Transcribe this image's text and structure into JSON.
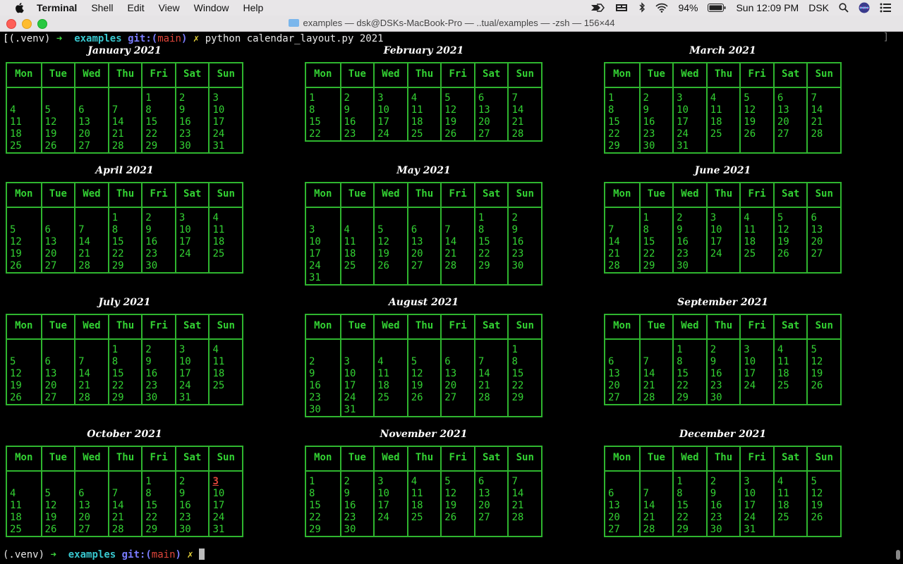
{
  "menubar": {
    "app": "Terminal",
    "items": [
      "Shell",
      "Edit",
      "View",
      "Window",
      "Help"
    ],
    "battery": "94%",
    "clock": "Sun 12:09 PM",
    "user": "DSK"
  },
  "window": {
    "title": "examples — dsk@DSKs-MacBook-Pro — ..tual/examples — -zsh — 156×44"
  },
  "prompt": {
    "venv": "(.venv)",
    "arrow": "➜",
    "dir": "examples",
    "git": "git:(",
    "branch": "main",
    "git_close": ")",
    "dirty": "✗",
    "command": "python calendar_layout.py 2021"
  },
  "weekdays": [
    "Mon",
    "Tue",
    "Wed",
    "Thu",
    "Fri",
    "Sat",
    "Sun"
  ],
  "months": [
    {
      "name": "January 2021",
      "weeks": [
        [
          "",
          "",
          "",
          "",
          "1",
          "2",
          "3"
        ],
        [
          "4",
          "5",
          "6",
          "7",
          "8",
          "9",
          "10"
        ],
        [
          "11",
          "12",
          "13",
          "14",
          "15",
          "16",
          "17"
        ],
        [
          "18",
          "19",
          "20",
          "21",
          "22",
          "23",
          "24"
        ],
        [
          "25",
          "26",
          "27",
          "28",
          "29",
          "30",
          "31"
        ]
      ]
    },
    {
      "name": "February 2021",
      "weeks": [
        [
          "1",
          "2",
          "3",
          "4",
          "5",
          "6",
          "7"
        ],
        [
          "8",
          "9",
          "10",
          "11",
          "12",
          "13",
          "14"
        ],
        [
          "15",
          "16",
          "17",
          "18",
          "19",
          "20",
          "21"
        ],
        [
          "22",
          "23",
          "24",
          "25",
          "26",
          "27",
          "28"
        ]
      ]
    },
    {
      "name": "March 2021",
      "weeks": [
        [
          "1",
          "2",
          "3",
          "4",
          "5",
          "6",
          "7"
        ],
        [
          "8",
          "9",
          "10",
          "11",
          "12",
          "13",
          "14"
        ],
        [
          "15",
          "16",
          "17",
          "18",
          "19",
          "20",
          "21"
        ],
        [
          "22",
          "23",
          "24",
          "25",
          "26",
          "27",
          "28"
        ],
        [
          "29",
          "30",
          "31",
          "",
          "",
          "",
          ""
        ]
      ]
    },
    {
      "name": "April 2021",
      "weeks": [
        [
          "",
          "",
          "",
          "1",
          "2",
          "3",
          "4"
        ],
        [
          "5",
          "6",
          "7",
          "8",
          "9",
          "10",
          "11"
        ],
        [
          "12",
          "13",
          "14",
          "15",
          "16",
          "17",
          "18"
        ],
        [
          "19",
          "20",
          "21",
          "22",
          "23",
          "24",
          "25"
        ],
        [
          "26",
          "27",
          "28",
          "29",
          "30",
          "",
          ""
        ]
      ]
    },
    {
      "name": "May 2021",
      "weeks": [
        [
          "",
          "",
          "",
          "",
          "",
          "1",
          "2"
        ],
        [
          "3",
          "4",
          "5",
          "6",
          "7",
          "8",
          "9"
        ],
        [
          "10",
          "11",
          "12",
          "13",
          "14",
          "15",
          "16"
        ],
        [
          "17",
          "18",
          "19",
          "20",
          "21",
          "22",
          "23"
        ],
        [
          "24",
          "25",
          "26",
          "27",
          "28",
          "29",
          "30"
        ],
        [
          "31",
          "",
          "",
          "",
          "",
          "",
          ""
        ]
      ]
    },
    {
      "name": "June 2021",
      "weeks": [
        [
          "",
          "1",
          "2",
          "3",
          "4",
          "5",
          "6"
        ],
        [
          "7",
          "8",
          "9",
          "10",
          "11",
          "12",
          "13"
        ],
        [
          "14",
          "15",
          "16",
          "17",
          "18",
          "19",
          "20"
        ],
        [
          "21",
          "22",
          "23",
          "24",
          "25",
          "26",
          "27"
        ],
        [
          "28",
          "29",
          "30",
          "",
          "",
          "",
          ""
        ]
      ]
    },
    {
      "name": "July 2021",
      "weeks": [
        [
          "",
          "",
          "",
          "1",
          "2",
          "3",
          "4"
        ],
        [
          "5",
          "6",
          "7",
          "8",
          "9",
          "10",
          "11"
        ],
        [
          "12",
          "13",
          "14",
          "15",
          "16",
          "17",
          "18"
        ],
        [
          "19",
          "20",
          "21",
          "22",
          "23",
          "24",
          "25"
        ],
        [
          "26",
          "27",
          "28",
          "29",
          "30",
          "31",
          ""
        ]
      ]
    },
    {
      "name": "August 2021",
      "weeks": [
        [
          "",
          "",
          "",
          "",
          "",
          "",
          "1"
        ],
        [
          "2",
          "3",
          "4",
          "5",
          "6",
          "7",
          "8"
        ],
        [
          "9",
          "10",
          "11",
          "12",
          "13",
          "14",
          "15"
        ],
        [
          "16",
          "17",
          "18",
          "19",
          "20",
          "21",
          "22"
        ],
        [
          "23",
          "24",
          "25",
          "26",
          "27",
          "28",
          "29"
        ],
        [
          "30",
          "31",
          "",
          "",
          "",
          "",
          ""
        ]
      ]
    },
    {
      "name": "September 2021",
      "weeks": [
        [
          "",
          "",
          "1",
          "2",
          "3",
          "4",
          "5"
        ],
        [
          "6",
          "7",
          "8",
          "9",
          "10",
          "11",
          "12"
        ],
        [
          "13",
          "14",
          "15",
          "16",
          "17",
          "18",
          "19"
        ],
        [
          "20",
          "21",
          "22",
          "23",
          "24",
          "25",
          "26"
        ],
        [
          "27",
          "28",
          "29",
          "30",
          "",
          "",
          ""
        ]
      ]
    },
    {
      "name": "October 2021",
      "weeks": [
        [
          "",
          "",
          "",
          "",
          "1",
          "2",
          "3"
        ],
        [
          "4",
          "5",
          "6",
          "7",
          "8",
          "9",
          "10"
        ],
        [
          "11",
          "12",
          "13",
          "14",
          "15",
          "16",
          "17"
        ],
        [
          "18",
          "19",
          "20",
          "21",
          "22",
          "23",
          "24"
        ],
        [
          "25",
          "26",
          "27",
          "28",
          "29",
          "30",
          "31"
        ]
      ]
    },
    {
      "name": "November 2021",
      "weeks": [
        [
          "1",
          "2",
          "3",
          "4",
          "5",
          "6",
          "7"
        ],
        [
          "8",
          "9",
          "10",
          "11",
          "12",
          "13",
          "14"
        ],
        [
          "15",
          "16",
          "17",
          "18",
          "19",
          "20",
          "21"
        ],
        [
          "22",
          "23",
          "24",
          "25",
          "26",
          "27",
          "28"
        ],
        [
          "29",
          "30",
          "",
          "",
          "",
          "",
          ""
        ]
      ]
    },
    {
      "name": "December 2021",
      "weeks": [
        [
          "",
          "",
          "1",
          "2",
          "3",
          "4",
          "5"
        ],
        [
          "6",
          "7",
          "8",
          "9",
          "10",
          "11",
          "12"
        ],
        [
          "13",
          "14",
          "15",
          "16",
          "17",
          "18",
          "19"
        ],
        [
          "20",
          "21",
          "22",
          "23",
          "24",
          "25",
          "26"
        ],
        [
          "27",
          "28",
          "29",
          "30",
          "31",
          "",
          ""
        ]
      ]
    }
  ],
  "today": {
    "month": "October 2021",
    "day": "3"
  },
  "colors": {
    "grid": "#2fb52f",
    "text": "#33d233",
    "today": "#e0453a"
  }
}
